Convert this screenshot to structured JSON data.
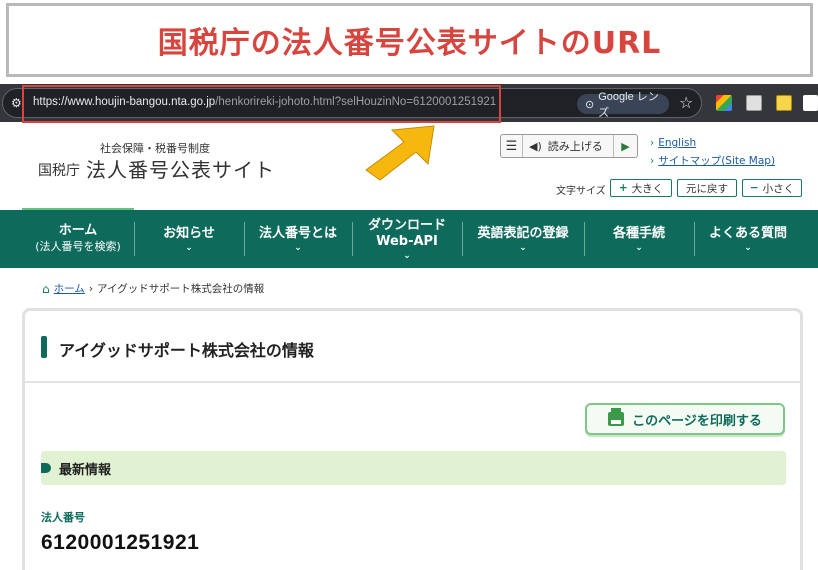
{
  "banner": {
    "title": "国税庁の法人番号公表サイトのURL"
  },
  "browser": {
    "url_host": "https://www.houjin-bangou.nta.go.jp",
    "url_path": "/henkorireki-johoto.html?selHouzinNo=6120001251921",
    "lens_label": "Google レンズ"
  },
  "header": {
    "subtitle": "社会保障・税番号制度",
    "org": "国税庁",
    "title": "法人番号公表サイト",
    "tts_label": "読み上げる",
    "links": [
      "English",
      "サイトマップ(Site Map)"
    ],
    "fontsize_label": "文字サイズ",
    "fontsize_buttons": {
      "larger": "大きく",
      "reset": "元に戻す",
      "smaller": "小さく"
    }
  },
  "nav": {
    "items": [
      {
        "label": "ホーム",
        "sub": "(法人番号を検索)"
      },
      {
        "label": "お知らせ"
      },
      {
        "label": "法人番号とは"
      },
      {
        "label": "ダウンロード",
        "sub": "Web-API"
      },
      {
        "label": "英語表記の登録"
      },
      {
        "label": "各種手続"
      },
      {
        "label": "よくある質問"
      }
    ]
  },
  "breadcrumb": {
    "home": "ホーム",
    "current": "アイグッドサポート株式会社の情報"
  },
  "main": {
    "title": "アイグッドサポート株式会社の情報",
    "print_label": "このページを印刷する",
    "section_title": "最新情報",
    "field_label": "法人番号",
    "field_value": "6120001251921"
  },
  "colors": {
    "accent": "#0e6b5c",
    "banner_text": "#d7453f",
    "highlight": "#d7453f",
    "arrow": "#f6b80f"
  }
}
